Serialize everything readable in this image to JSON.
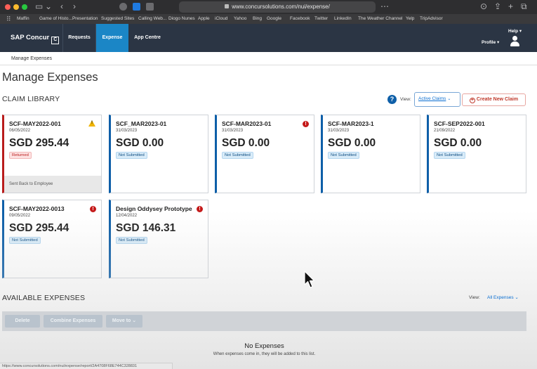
{
  "browser": {
    "url": "www.concursolutions.com/nui/expense/",
    "bookmarks": [
      "Maffin",
      "Game of Histo...Presentation",
      "Suggested Sites",
      "Calling Web...",
      "Diogo Nunes",
      "Apple",
      "iCloud",
      "Yahoo",
      "Bing",
      "Google",
      "Facebook",
      "Twitter",
      "LinkedIn",
      "The Weather Channel",
      "Yelp",
      "TripAdvisor"
    ],
    "status_url": "https://www.concursolutions.com/nui/expense/report/2A4708F68E744C328831"
  },
  "nav": {
    "brand": "SAP Concur",
    "brand_mark": "C",
    "items": [
      {
        "label": "Requests",
        "active": false
      },
      {
        "label": "Expense",
        "active": true
      },
      {
        "label": "App Centre",
        "active": false
      }
    ],
    "help": "Help",
    "profile": "Profile",
    "active_color": "#1b86c6",
    "bar_color": "#2b3544"
  },
  "breadcrumb": "Manage Expenses",
  "page_title": "Manage Expenses",
  "claim_library": {
    "title": "CLAIM LIBRARY",
    "view_label": "View:",
    "view_value": "Active Claims",
    "create_label": "Create New Claim"
  },
  "claims": [
    {
      "name": "SCF-MAY2022-001",
      "date": "06/05/2022",
      "amount": "SGD 295.44",
      "status": "Returned",
      "icon": "warning-icon",
      "footer": "Sent Back to Employee"
    },
    {
      "name": "SCF_MAR2023-01",
      "date": "31/03/2023",
      "amount": "SGD 0.00",
      "status": "Not Submitted",
      "icon": "",
      "footer": ""
    },
    {
      "name": "SCF-MAR2023-01",
      "date": "31/03/2023",
      "amount": "SGD 0.00",
      "status": "Not Submitted",
      "icon": "alert-icon",
      "footer": ""
    },
    {
      "name": "SCF-MAR2023-1",
      "date": "31/03/2023",
      "amount": "SGD 0.00",
      "status": "Not Submitted",
      "icon": "",
      "footer": ""
    },
    {
      "name": "SCF-SEP2022-001",
      "date": "21/09/2022",
      "amount": "SGD 0.00",
      "status": "Not Submitted",
      "icon": "",
      "footer": ""
    },
    {
      "name": "SCF-MAY2022-0013",
      "date": "09/05/2022",
      "amount": "SGD 295.44",
      "status": "Not Submitted",
      "icon": "alert-icon",
      "footer": ""
    },
    {
      "name": "Design Oddysey Prototype",
      "date": "12/04/2022",
      "amount": "SGD 146.31",
      "status": "Not Submitted",
      "icon": "alert-icon",
      "footer": ""
    }
  ],
  "available_expenses": {
    "title": "AVAILABLE EXPENSES",
    "view_label": "View:",
    "view_value": "All Expenses",
    "actions": [
      "Delete",
      "Combine Expenses",
      "Move to"
    ],
    "empty_title": "No Expenses",
    "empty_subtitle": "When expenses come in, they will be added to this list."
  }
}
